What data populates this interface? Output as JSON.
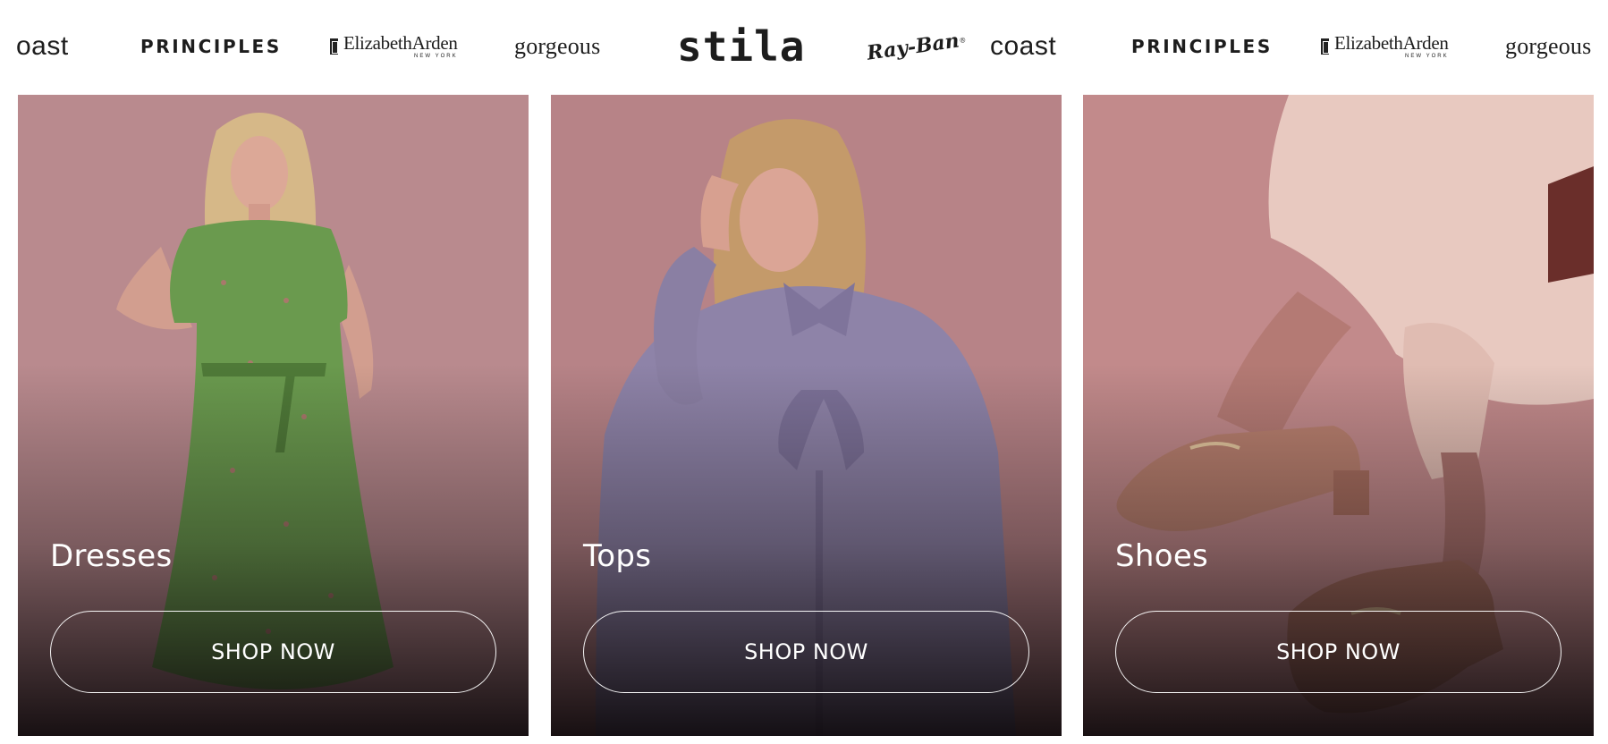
{
  "brand_strip": {
    "brands": [
      {
        "name": "coast",
        "display": "oast"
      },
      {
        "name": "principles",
        "display": "PRINCIPLES"
      },
      {
        "name": "elizabeth-arden",
        "display": "ElizabethArden",
        "sub": "NEW YORK"
      },
      {
        "name": "gorgeous",
        "display": "gorgeous"
      },
      {
        "name": "stila",
        "display": "stila"
      },
      {
        "name": "ray-ban",
        "display": "Ray-Ban",
        "mark": "®"
      },
      {
        "name": "coast",
        "display": "coast"
      },
      {
        "name": "principles",
        "display": "PRINCIPLES"
      },
      {
        "name": "elizabeth-arden",
        "display": "ElizabethArden",
        "sub": "NEW YORK"
      },
      {
        "name": "gorgeous",
        "display": "gorgeous"
      }
    ]
  },
  "categories": [
    {
      "title": "Dresses",
      "cta": "SHOP NOW",
      "image": "model-green-floral-dress"
    },
    {
      "title": "Tops",
      "cta": "SHOP NOW",
      "image": "model-lavender-pussybow-blouse"
    },
    {
      "title": "Shoes",
      "cta": "SHOP NOW",
      "image": "tan-loafers-cream-trousers"
    }
  ],
  "colors": {
    "overlay_tint": "#b5848a",
    "text_on_card": "#ffffff",
    "dress_green": "#6a9a4e",
    "blouse_lavender": "#8e83a8",
    "loafer_tan": "#b9806f"
  }
}
